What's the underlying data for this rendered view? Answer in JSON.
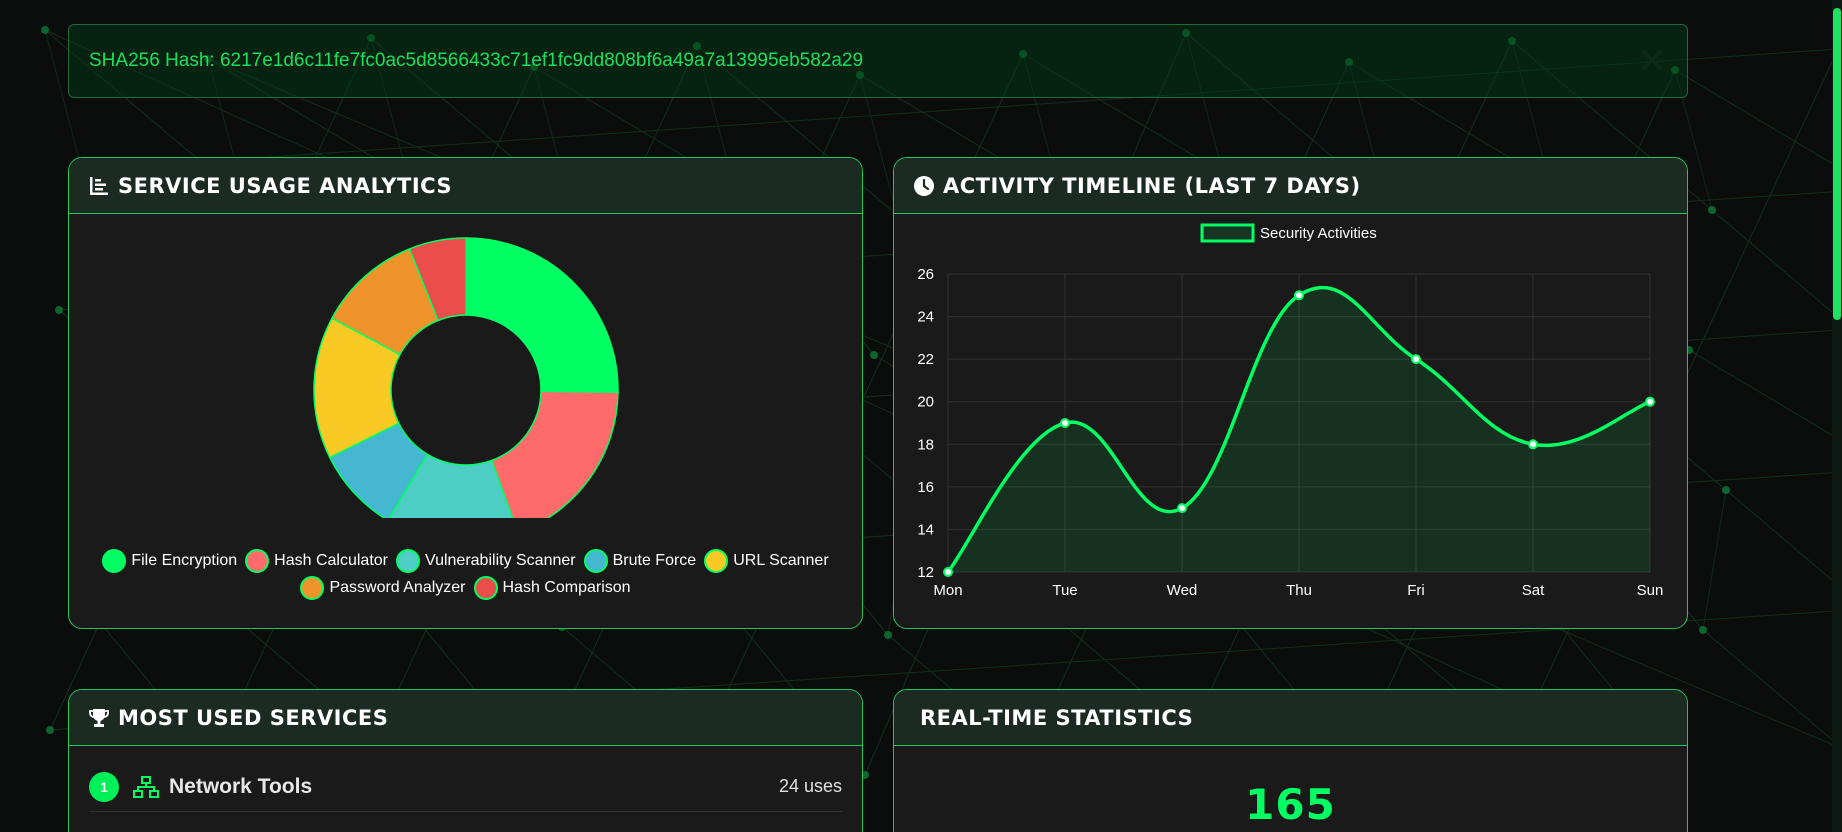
{
  "hash_alert": {
    "text": "SHA256 Hash: 6217e1d6c11fe7fc0ac5d8566433c71ef1fc9dd808bf6a49a7a13995eb582a29",
    "close_icon": "close-icon"
  },
  "usage_card": {
    "title": "Service Usage Analytics",
    "icon": "chart-bars-icon"
  },
  "timeline_card": {
    "title": "Activity Timeline (Last 7 Days)",
    "icon": "clock-icon"
  },
  "services_card": {
    "title": "Most Used Services",
    "icon": "trophy-icon",
    "items": [
      {
        "rank": "1",
        "name": "Network Tools",
        "uses": "24 uses",
        "icon": "network-icon"
      }
    ]
  },
  "stats_card": {
    "title": "Real-Time Statistics",
    "value": "165"
  },
  "colors": {
    "accent": "#00ff62",
    "card_bg": "#1a1a1a",
    "header_bg": "#1b2b21"
  },
  "chart_data": [
    {
      "type": "pie",
      "variant": "doughnut",
      "categories": [
        "File Encryption",
        "Hash Calculator",
        "Vulnerability Scanner",
        "Brute Force",
        "URL Scanner",
        "Password Analyzer",
        "Hash Comparison"
      ],
      "values": [
        25,
        19,
        14,
        9,
        15,
        11,
        6
      ],
      "colors": [
        "#00ff62",
        "#ff6b6b",
        "#4ecdc4",
        "#45b7d1",
        "#f9ca24",
        "#f0932b",
        "#eb4d4b"
      ],
      "legend": "bottom"
    },
    {
      "type": "line",
      "series": [
        {
          "name": "Security Activities",
          "values": [
            12,
            19,
            15,
            25,
            22,
            18,
            20
          ]
        }
      ],
      "categories": [
        "Mon",
        "Tue",
        "Wed",
        "Thu",
        "Fri",
        "Sat",
        "Sun"
      ],
      "ylim": [
        12,
        26
      ],
      "yticks": [
        12,
        14,
        16,
        18,
        20,
        22,
        24,
        26
      ],
      "grid": true,
      "legend": "top",
      "fill": true,
      "color": "#00ff62"
    }
  ]
}
